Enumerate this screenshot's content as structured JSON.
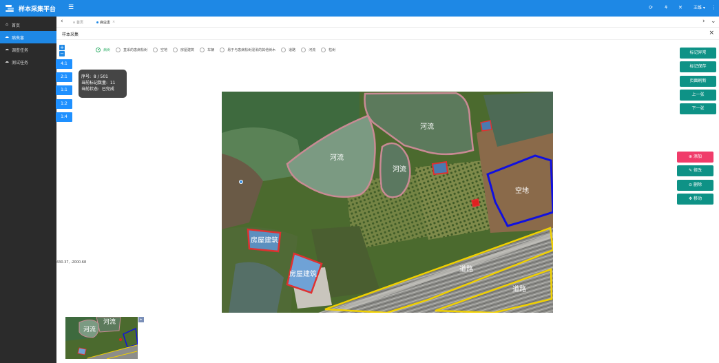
{
  "app": {
    "brand": "样本采集平台",
    "user_name": "王维"
  },
  "sidebar": {
    "items": [
      {
        "label": "首页",
        "icon": "home-icon",
        "active": false
      },
      {
        "label": "病虫害",
        "icon": "cloud-icon",
        "active": true
      },
      {
        "label": "调查任务",
        "icon": "cloud-icon",
        "active": false
      },
      {
        "label": "测试任务",
        "icon": "cloud-icon",
        "active": false
      }
    ]
  },
  "tabs": [
    {
      "label": "首页",
      "active": false
    },
    {
      "label": "病虫害",
      "active": true
    }
  ],
  "page": {
    "title": "样本采集"
  },
  "scale_buttons": [
    "4:1",
    "2:1",
    "1:1",
    "1:2",
    "1:4"
  ],
  "categories": [
    {
      "label": "病树",
      "selected": true
    },
    {
      "label": "直采的患病松树",
      "selected": false
    },
    {
      "label": "空地",
      "selected": false
    },
    {
      "label": "房屋建筑",
      "selected": false
    },
    {
      "label": "车辆",
      "selected": false
    },
    {
      "label": "易于与患病松树混淆的其他树木",
      "selected": false
    },
    {
      "label": "道路",
      "selected": false
    },
    {
      "label": "河流",
      "selected": false
    },
    {
      "label": "枯树",
      "selected": false
    }
  ],
  "info": {
    "seq_label": "序号:",
    "seq_value": "8 / 501",
    "count_label": "当前标记数量:",
    "count_value": "11",
    "status_label": "当前状态:",
    "status_value": "已完成"
  },
  "coordinates": "430.37, -2000.68",
  "right_buttons": [
    "标记异常",
    "标记保存",
    "页面刷新",
    "上一张",
    "下一张"
  ],
  "edit_buttons": [
    {
      "label": "添加",
      "icon": "plus-circle-icon"
    },
    {
      "label": "修改",
      "icon": "edit-icon"
    },
    {
      "label": "删除",
      "icon": "minus-circle-icon"
    },
    {
      "label": "移动",
      "icon": "move-icon"
    }
  ],
  "annotations": [
    {
      "label": "河流"
    },
    {
      "label": "河流"
    },
    {
      "label": "河流"
    },
    {
      "label": "空地"
    },
    {
      "label": "房屋建筑"
    },
    {
      "label": "房屋建筑"
    },
    {
      "label": "道路"
    },
    {
      "label": "道路"
    }
  ],
  "minimap": {
    "labels": [
      "河流",
      "河流"
    ]
  },
  "colors": {
    "primary": "#1e88e5",
    "sidebar": "#2b2b2b",
    "teal": "#0e9286",
    "add": "#f03c6a",
    "river": "#c98a94",
    "land": "#1010e0",
    "building": "#e03030",
    "road": "#f0d000"
  }
}
